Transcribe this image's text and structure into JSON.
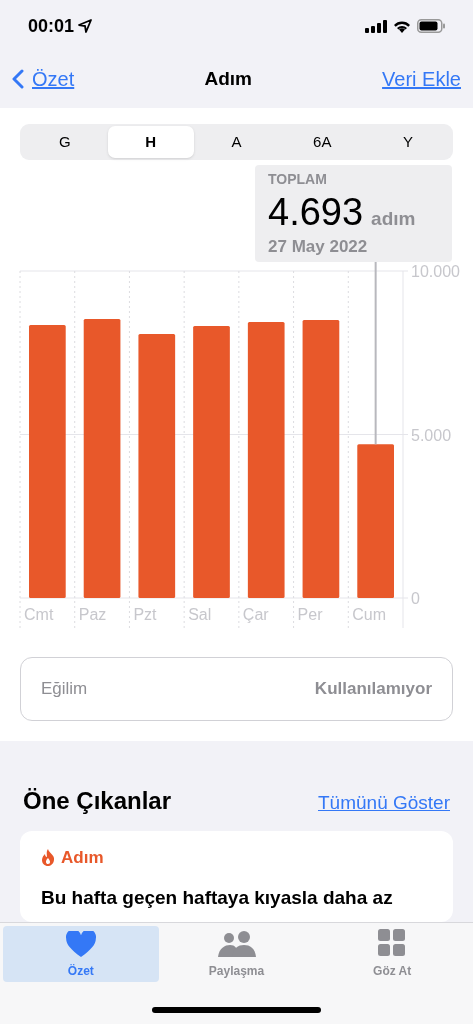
{
  "status_bar": {
    "time": "00:01"
  },
  "nav": {
    "back": "Özet",
    "title": "Adım",
    "action": "Veri Ekle"
  },
  "segments": [
    {
      "label": "G",
      "selected": false
    },
    {
      "label": "H",
      "selected": true
    },
    {
      "label": "A",
      "selected": false
    },
    {
      "label": "6A",
      "selected": false
    },
    {
      "label": "Y",
      "selected": false
    }
  ],
  "summary": {
    "label": "TOPLAM",
    "value": "4.693",
    "unit": "adım",
    "date": "27 May 2022"
  },
  "chart_data": {
    "type": "bar",
    "categories": [
      "Cmt",
      "Paz",
      "Pzt",
      "Sal",
      "Çar",
      "Per",
      "Cum"
    ],
    "series": [
      {
        "color": "#e8582a",
        "values": [
          8350,
          8530,
          8070,
          8320,
          8440,
          8500,
          4700
        ]
      }
    ],
    "ylim": [
      0,
      10000
    ],
    "yticks": [
      {
        "value": 0,
        "label": "0"
      },
      {
        "value": 5000,
        "label": "5.000"
      },
      {
        "value": 10000,
        "label": "10.000"
      }
    ]
  },
  "trend": {
    "label": "Eğilim",
    "value": "Kullanılamıyor"
  },
  "highlights": {
    "title": "Öne Çıkanlar",
    "link": "Tümünü Göster",
    "cards": [
      {
        "category": "Adım",
        "text": "Bu hafta geçen haftaya kıyasla daha az"
      }
    ]
  },
  "tab_bar": [
    {
      "label": "Özet",
      "selected": true
    },
    {
      "label": "Paylaşma",
      "selected": false
    },
    {
      "label": "Göz At",
      "selected": false
    }
  ]
}
